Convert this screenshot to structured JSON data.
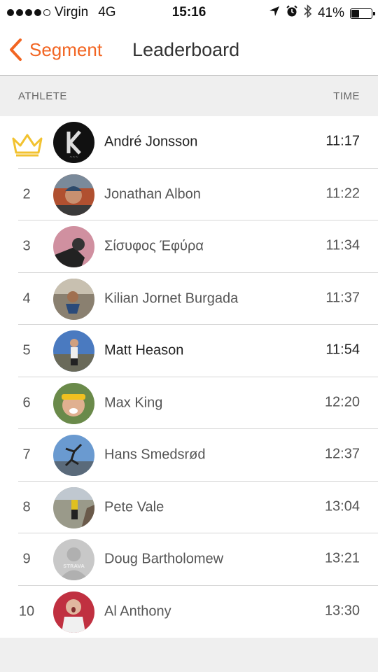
{
  "status_bar": {
    "carrier": "Virgin",
    "network": "4G",
    "time": "15:16",
    "battery_percent": "41%",
    "battery_level": 0.41,
    "signal_bars_filled": 4,
    "icons": [
      "location-arrow-icon",
      "alarm-icon",
      "bluetooth-icon",
      "battery-icon"
    ]
  },
  "nav": {
    "back_label": "Segment",
    "title": "Leaderboard"
  },
  "columns": {
    "athlete": "ATHLETE",
    "time": "TIME"
  },
  "leaderboard": [
    {
      "rank": "",
      "is_leader": true,
      "name": "André Jonsson",
      "time": "11:17",
      "highlight": true
    },
    {
      "rank": "2",
      "is_leader": false,
      "name": "Jonathan Albon",
      "time": "11:22",
      "highlight": false
    },
    {
      "rank": "3",
      "is_leader": false,
      "name": "Σίσυφος Έφύρα",
      "time": "11:34",
      "highlight": false
    },
    {
      "rank": "4",
      "is_leader": false,
      "name": "Kilian Jornet Burgada",
      "time": "11:37",
      "highlight": false
    },
    {
      "rank": "5",
      "is_leader": false,
      "name": "Matt Heason",
      "time": "11:54",
      "highlight": true
    },
    {
      "rank": "6",
      "is_leader": false,
      "name": "Max King",
      "time": "12:20",
      "highlight": false
    },
    {
      "rank": "7",
      "is_leader": false,
      "name": "Hans Smedsrød",
      "time": "12:37",
      "highlight": false
    },
    {
      "rank": "8",
      "is_leader": false,
      "name": "Pete Vale",
      "time": "13:04",
      "highlight": false
    },
    {
      "rank": "9",
      "is_leader": false,
      "name": "Doug Bartholomew",
      "time": "13:21",
      "highlight": false
    },
    {
      "rank": "10",
      "is_leader": false,
      "name": "Al Anthony",
      "time": "13:30",
      "highlight": false
    }
  ],
  "colors": {
    "accent": "#f26522",
    "crown": "#f2c230",
    "text_primary": "#222222",
    "text_secondary": "#555555"
  }
}
